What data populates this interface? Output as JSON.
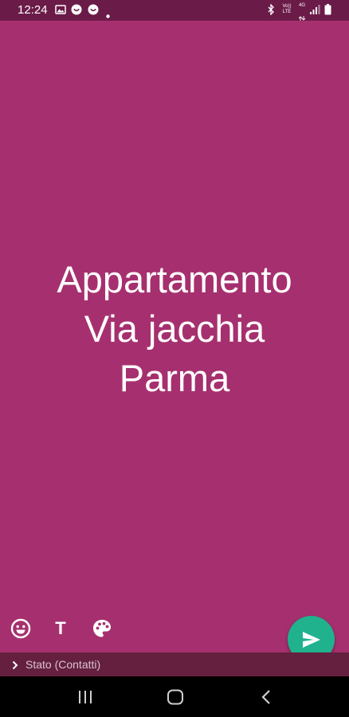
{
  "status_bar": {
    "time": "12:24",
    "volte_label": "Vo)) LTE",
    "network_label": "4G"
  },
  "status": {
    "text_lines": [
      "Appartamento",
      "Via jacchia",
      "Parma"
    ],
    "background_color": "#a6306f"
  },
  "toolbar": {
    "emoji_icon": "emoji-icon",
    "text_label": "T",
    "palette_icon": "palette-icon"
  },
  "send": {
    "icon": "send-icon",
    "color": "#1fb28d"
  },
  "audience": {
    "label": "Stato (Contatti)"
  },
  "nav": {
    "recents_icon": "recents-icon",
    "home_icon": "home-icon",
    "back_icon": "back-icon"
  }
}
